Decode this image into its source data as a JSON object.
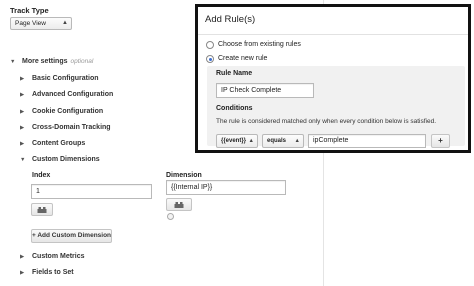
{
  "track_type": {
    "label": "Track Type",
    "selected": "Page View"
  },
  "more_settings": {
    "label": "More settings",
    "hint": "optional"
  },
  "sections": [
    {
      "label": "Basic Configuration"
    },
    {
      "label": "Advanced Configuration"
    },
    {
      "label": "Cookie Configuration"
    },
    {
      "label": "Cross-Domain Tracking"
    },
    {
      "label": "Content Groups"
    },
    {
      "label": "Custom Dimensions"
    }
  ],
  "custom_dimensions": {
    "index_label": "Index",
    "index_value": "1",
    "dimension_label": "Dimension",
    "dimension_value": "{{Internal IP}}",
    "add_button": "+ Add Custom Dimension"
  },
  "more_sections": [
    {
      "label": "Custom Metrics"
    },
    {
      "label": "Fields to Set"
    }
  ],
  "dialog": {
    "title": "Add Rule(s)",
    "option_existing": "Choose from existing rules",
    "option_new": "Create new rule",
    "rule_name_label": "Rule Name",
    "rule_name_value": "IP Check Complete",
    "conditions_label": "Conditions",
    "conditions_desc": "The rule is considered matched only when every condition below is satisfied.",
    "macro": "{{event}}",
    "operator": "equals",
    "condition_value": "ipComplete",
    "add_condition": "+"
  },
  "colors": {
    "dialog_border": "#111111",
    "radio_selected": "#3d6fd1"
  }
}
